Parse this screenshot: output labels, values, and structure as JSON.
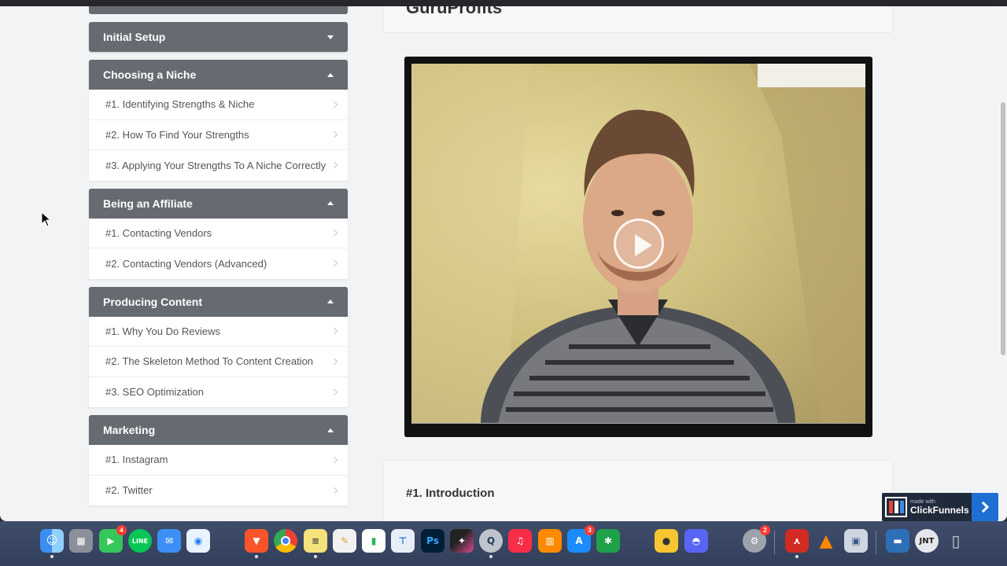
{
  "course": {
    "title": "GuruProfits"
  },
  "sidebar": {
    "modules": [
      {
        "title": "Initial Setup",
        "expanded": false,
        "lessons": []
      },
      {
        "title": "Choosing a Niche",
        "expanded": true,
        "lessons": [
          "#1. Identifying Strengths & Niche",
          "#2. How To Find Your Strengths",
          "#3. Applying Your Strengths To A Niche Correctly"
        ]
      },
      {
        "title": "Being an Affiliate",
        "expanded": true,
        "lessons": [
          "#1. Contacting Vendors",
          "#2. Contacting Vendors (Advanced)"
        ]
      },
      {
        "title": "Producing Content",
        "expanded": true,
        "lessons": [
          "#1. Why You Do Reviews",
          "#2. The Skeleton Method To Content Creation",
          "#3. SEO Optimization"
        ]
      },
      {
        "title": "Marketing",
        "expanded": true,
        "lessons": [
          "#1. Instagram",
          "#2. Twitter"
        ]
      }
    ]
  },
  "video": {
    "icon": "play-icon"
  },
  "current_lesson": {
    "title": "#1. Introduction"
  },
  "badge": {
    "made_with": "made with",
    "brand": "ClickFunnels"
  },
  "dock": {
    "badges": {
      "facetime": "4",
      "appstore": "3",
      "settings": "2"
    }
  },
  "colors": {
    "module_header": "#666b71",
    "page_bg": "#f2f3f5",
    "badge_blue": "#1e6fd1"
  }
}
